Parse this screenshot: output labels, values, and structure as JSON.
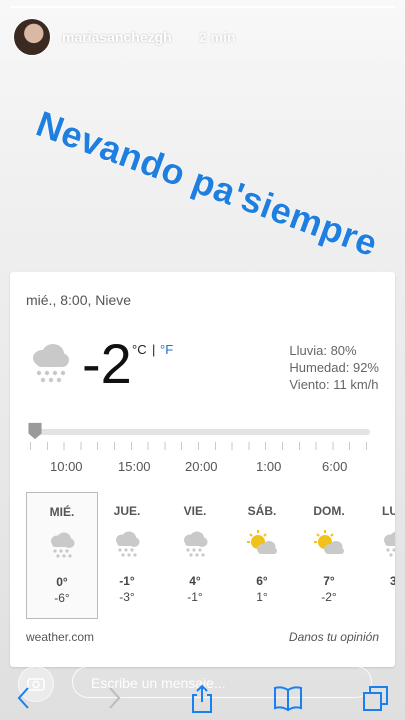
{
  "story": {
    "username": "mariasanchezgh",
    "time_ago": "2 min",
    "caption": "Nevando pa'siempre"
  },
  "weather": {
    "summary": "mié., 8:00, Nieve",
    "temperature": "-2",
    "unit_c": "°C",
    "unit_sep": "|",
    "unit_f": "°F",
    "details": {
      "rain": "Lluvia: 80%",
      "humidity": "Humedad: 92%",
      "wind": "Viento: 11 km/h"
    },
    "timeline_position": 0.0,
    "hours": [
      "10:00",
      "15:00",
      "20:00",
      "1:00",
      "6:00"
    ],
    "days": [
      {
        "name": "MIÉ.",
        "high": "0°",
        "low": "-6°",
        "icon": "snow-cloud-icon"
      },
      {
        "name": "JUE.",
        "high": "-1°",
        "low": "-3°",
        "icon": "snow-cloud-icon"
      },
      {
        "name": "VIE.",
        "high": "4°",
        "low": "-1°",
        "icon": "snow-cloud-icon"
      },
      {
        "name": "SÁB.",
        "high": "6°",
        "low": "1°",
        "icon": "partly-sunny-icon"
      },
      {
        "name": "DOM.",
        "high": "7°",
        "low": "-2°",
        "icon": "partly-sunny-icon"
      },
      {
        "name": "LU",
        "high": "3",
        "low": "",
        "icon": "snow-cloud-icon"
      }
    ],
    "source": "weather.com",
    "feedback": "Danos tu opinión"
  },
  "message": {
    "placeholder": "Escribe un mensaje..."
  },
  "colors": {
    "caption": "#1f7fe0",
    "fahrenheit_link": "#1a73c9",
    "sun": "#f2c21b"
  }
}
